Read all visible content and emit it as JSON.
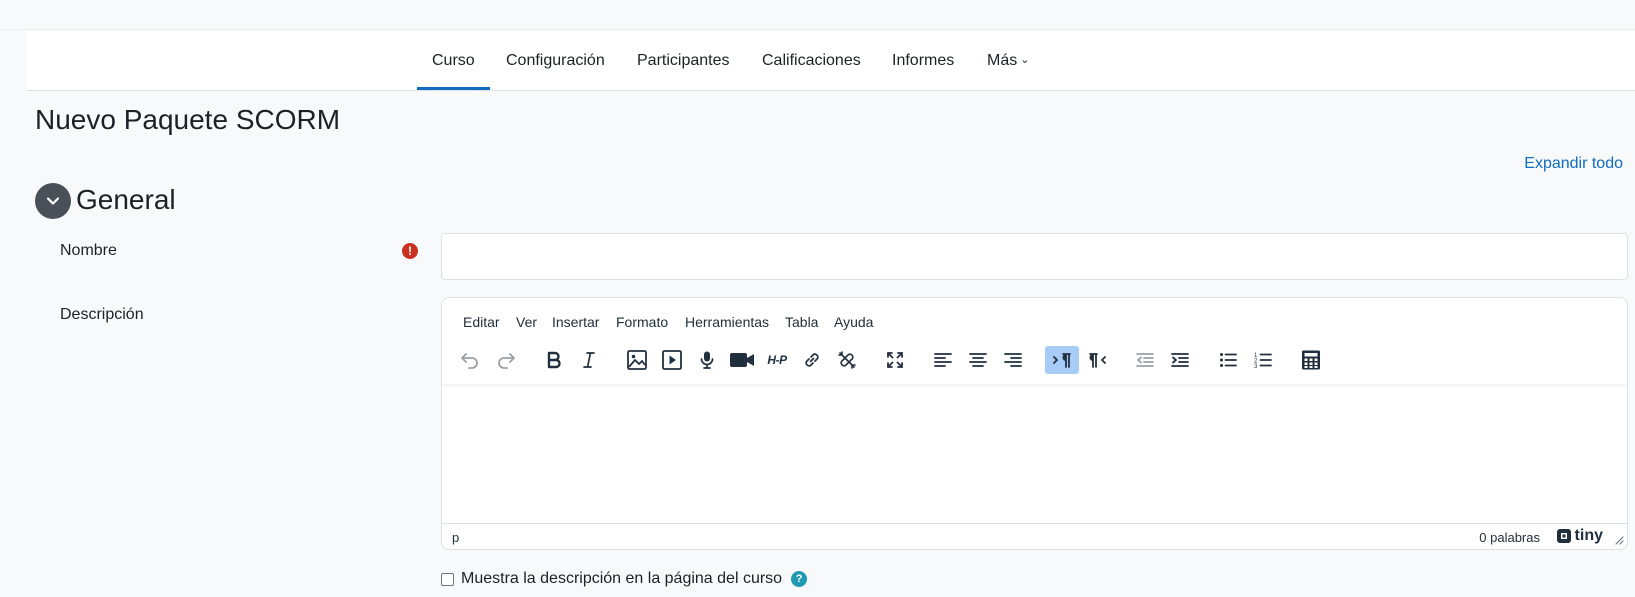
{
  "nav": {
    "tabs": [
      {
        "label": "Curso",
        "active": true
      },
      {
        "label": "Configuración"
      },
      {
        "label": "Participantes"
      },
      {
        "label": "Calificaciones"
      },
      {
        "label": "Informes"
      },
      {
        "label": "Más"
      }
    ],
    "accent": "#0f6cbf"
  },
  "page": {
    "title": "Nuevo Paquete SCORM",
    "expand_all": "Expandir todo"
  },
  "section": {
    "title": "General",
    "toggle_icon": "chevron-down-icon"
  },
  "form": {
    "name_label": "Nombre",
    "name_value": "",
    "required_icon": "exclamation-circle-icon",
    "required_color": "#ca3120",
    "description_label": "Descripción",
    "show_description_label": "Muestra la descripción en la página del curso",
    "show_description_checked": false,
    "help_icon": "question-circle-icon",
    "help_color": "#1f9ab2"
  },
  "editor": {
    "menus": [
      "Editar",
      "Ver",
      "Insertar",
      "Formato",
      "Herramientas",
      "Tabla",
      "Ayuda"
    ],
    "toolbar": [
      "undo-icon",
      "redo-icon",
      "bold-icon",
      "italic-icon",
      "image-icon",
      "media-icon",
      "microphone-icon",
      "video-camera-icon",
      "h5p-icon",
      "link-icon",
      "unlink-icon",
      "fullscreen-icon",
      "align-left-icon",
      "align-center-icon",
      "align-right-icon",
      "ltr-icon",
      "rtl-icon",
      "outdent-icon",
      "indent-icon",
      "bullet-list-icon",
      "numbered-list-icon",
      "calculator-icon"
    ],
    "active_tool": "ltr-icon",
    "h5p_text": "H-P",
    "content": "",
    "path": "p",
    "word_count": "0 palabras",
    "brand": "tiny"
  }
}
